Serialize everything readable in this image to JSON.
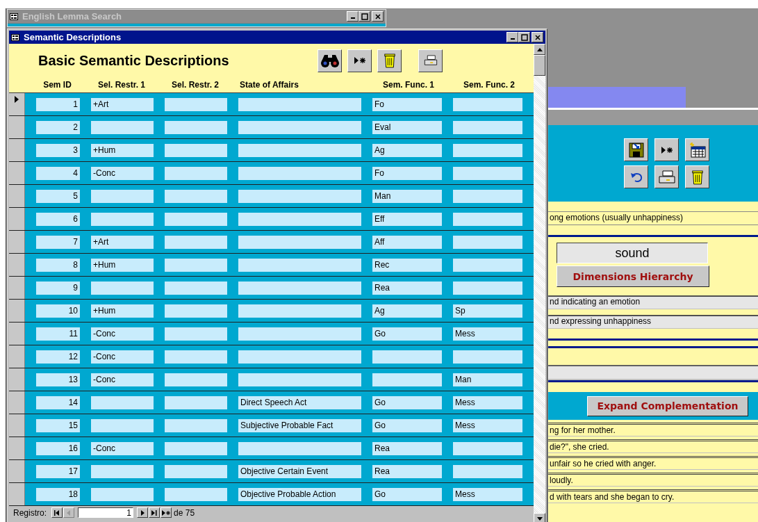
{
  "background_window": {
    "title": "English Lemma Search",
    "active": false,
    "definition": "ong emotions (usually unhappiness)",
    "lemma": "sound",
    "hierarchy_button": "Dimensions Hierarchy",
    "senses": [
      "nd indicating an emotion",
      "nd expressing unhappiness"
    ],
    "complementation_button": "Expand Complementation",
    "examples": [
      "ng for her mother.",
      "die?\", she cried.",
      "unfair so he cried with anger.",
      "loudly.",
      "d with tears and she began to cry."
    ]
  },
  "window": {
    "title": "Semantic Descriptions",
    "active": true
  },
  "form": {
    "heading": "Basic Semantic Descriptions",
    "columns": [
      "Sem ID",
      "Sel. Restr. 1",
      "Sel. Restr. 2",
      "State of Affairs",
      "Sem. Func. 1",
      "Sem. Func. 2"
    ],
    "rows": [
      {
        "selected": true,
        "cells": [
          "1",
          "+Art",
          "",
          "",
          "Fo",
          ""
        ]
      },
      {
        "selected": false,
        "cells": [
          "2",
          "",
          "",
          "",
          "Eval",
          ""
        ]
      },
      {
        "selected": false,
        "cells": [
          "3",
          "+Hum",
          "",
          "",
          "Ag",
          ""
        ]
      },
      {
        "selected": false,
        "cells": [
          "4",
          "-Conc",
          "",
          "",
          "Fo",
          ""
        ]
      },
      {
        "selected": false,
        "cells": [
          "5",
          "",
          "",
          "",
          "Man",
          ""
        ]
      },
      {
        "selected": false,
        "cells": [
          "6",
          "",
          "",
          "",
          "Eff",
          ""
        ]
      },
      {
        "selected": false,
        "cells": [
          "7",
          "+Art",
          "",
          "",
          "Aff",
          ""
        ]
      },
      {
        "selected": false,
        "cells": [
          "8",
          "+Hum",
          "",
          "",
          "Rec",
          ""
        ]
      },
      {
        "selected": false,
        "cells": [
          "9",
          "",
          "",
          "",
          "Rea",
          ""
        ]
      },
      {
        "selected": false,
        "cells": [
          "10",
          "+Hum",
          "",
          "",
          "Ag",
          "Sp"
        ]
      },
      {
        "selected": false,
        "cells": [
          "11",
          "-Conc",
          "",
          "",
          "Go",
          "Mess"
        ]
      },
      {
        "selected": false,
        "cells": [
          "12",
          "-Conc",
          "",
          "",
          "",
          ""
        ]
      },
      {
        "selected": false,
        "cells": [
          "13",
          "-Conc",
          "",
          "",
          "",
          "Man"
        ]
      },
      {
        "selected": false,
        "cells": [
          "14",
          "",
          "",
          "Direct Speech Act",
          "Go",
          "Mess"
        ]
      },
      {
        "selected": false,
        "cells": [
          "15",
          "",
          "",
          "Subjective Probable Fact",
          "Go",
          "Mess"
        ]
      },
      {
        "selected": false,
        "cells": [
          "16",
          "-Conc",
          "",
          "",
          "Rea",
          ""
        ]
      },
      {
        "selected": false,
        "cells": [
          "17",
          "",
          "",
          "Objective Certain Event",
          "Rea",
          ""
        ]
      },
      {
        "selected": false,
        "cells": [
          "18",
          "",
          "",
          "Objective Probable Action",
          "Go",
          "Mess"
        ]
      }
    ]
  },
  "navigation": {
    "label": "Registro:",
    "current": "1",
    "total": "de 75",
    "buttons": [
      {
        "kind": "first",
        "disabled": false
      },
      {
        "kind": "prev",
        "disabled": true
      },
      {
        "kind": "next",
        "disabled": false
      },
      {
        "kind": "last",
        "disabled": false
      },
      {
        "kind": "new",
        "disabled": false
      }
    ]
  }
}
